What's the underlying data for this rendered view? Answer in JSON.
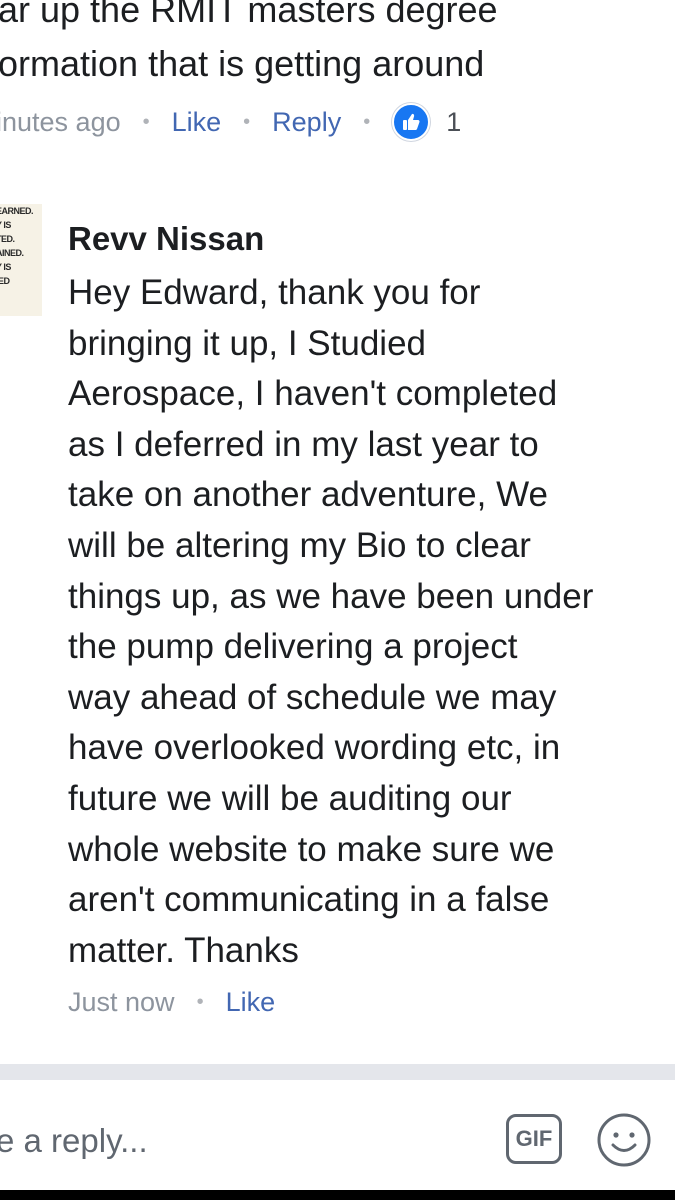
{
  "previous_comment": {
    "line1": "ar up the RMIT masters degree",
    "line2": "ormation that is getting around",
    "time": "inutes ago",
    "like_label": "Like",
    "reply_label": "Reply",
    "reaction_count": "1"
  },
  "reply": {
    "avatar_text": [
      "EARNED.",
      "Y IS",
      "TED.",
      "AINED.",
      "Y IS",
      "IED"
    ],
    "author": "Revv Nissan",
    "lines": [
      "Hey Edward, thank you for",
      "bringing it up, I Studied",
      "Aerospace, I haven't completed",
      "as I deferred in my last year to",
      "take on another adventure, We",
      "will be altering my Bio to clear",
      "things up, as we have been under",
      "the pump delivering a project",
      "way ahead of schedule we may",
      "have overlooked wording etc, in",
      "future we will be auditing our",
      "whole website to make sure we",
      "aren't communicating in a false",
      "matter. Thanks"
    ],
    "time": "Just now",
    "like_label": "Like"
  },
  "composer": {
    "placeholder": "e a reply...",
    "gif_label": "GIF",
    "emoji_icon": "smiley-icon"
  },
  "colors": {
    "link": "#4267b2",
    "meta": "#8d949e",
    "like_badge": "#1877f2"
  }
}
